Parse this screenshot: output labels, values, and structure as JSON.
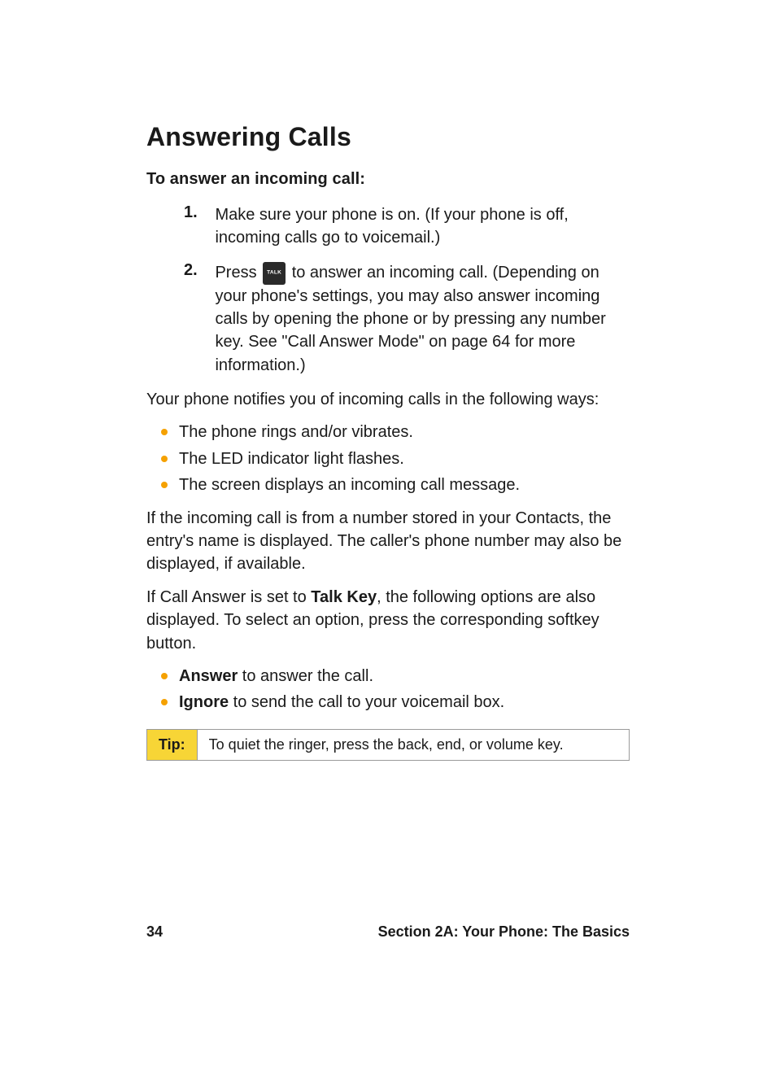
{
  "heading": "Answering Calls",
  "subheading": "To answer an incoming call:",
  "steps": [
    {
      "num": "1.",
      "text": "Make sure your phone is on. (If your phone is off, incoming calls go to voicemail.)"
    },
    {
      "num": "2.",
      "pre": "Press ",
      "icon": "TALK",
      "post": " to answer an incoming call. (Depending on your phone's settings, you may also answer incoming calls by opening the phone or by pressing any number key. See \"Call Answer Mode\" on page 64 for more information.)"
    }
  ],
  "para_notify": "Your phone notifies you of incoming calls in the following ways:",
  "notify_items": [
    "The phone rings and/or vibrates.",
    "The LED indicator light flashes.",
    "The screen displays an incoming call message."
  ],
  "para_contacts": "If the incoming call is from a number stored in your Contacts, the entry's name is displayed. The caller's phone number may also be displayed, if available.",
  "para_talkkey_pre": "If Call Answer is set to ",
  "para_talkkey_bold": "Talk Key",
  "para_talkkey_post": ", the following options are also displayed. To select an option, press the corresponding softkey button.",
  "options": [
    {
      "bold": "Answer",
      "rest": " to answer the call."
    },
    {
      "bold": "Ignore",
      "rest": " to send the call to your voicemail box."
    }
  ],
  "tip": {
    "label": "Tip:",
    "text": "To quiet the ringer, press the back, end, or volume key."
  },
  "footer": {
    "page": "34",
    "section": "Section 2A: Your Phone: The Basics"
  }
}
